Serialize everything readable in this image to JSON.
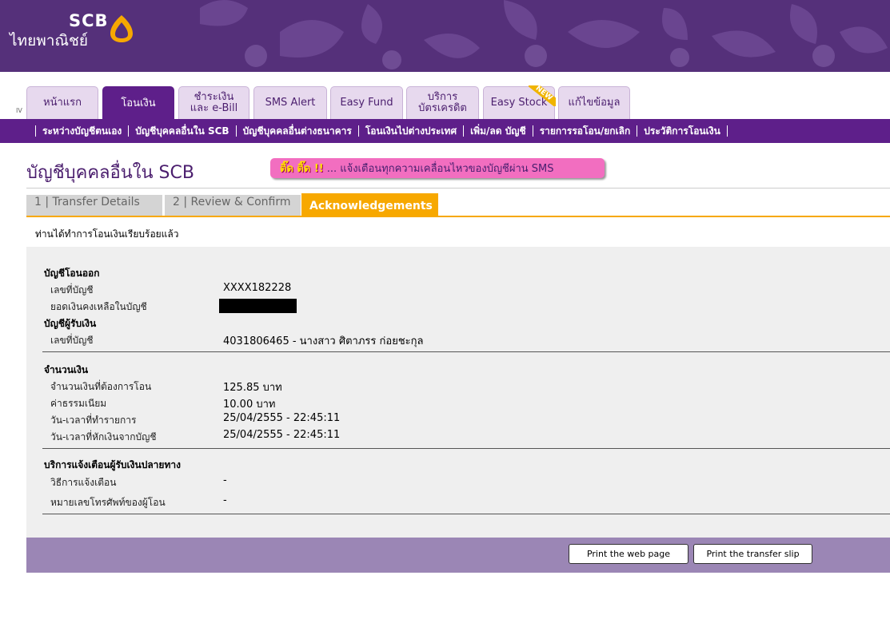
{
  "brand": {
    "name": "SCB",
    "thai_name": "ไทยพาณิชย์",
    "colors": {
      "primary": "#5e1f8a",
      "accent": "#f7a800",
      "banner": "#55307a"
    }
  },
  "side_mark": "IV",
  "tabs": [
    {
      "label": "หน้าแรก"
    },
    {
      "label": "โอนเงิน",
      "active": true
    },
    {
      "label": "ชำระเงิน และ e-Bill"
    },
    {
      "label": "SMS Alert"
    },
    {
      "label": "Easy Fund"
    },
    {
      "label": "บริการ บัตรเครดิต"
    },
    {
      "label": "Easy Stock",
      "badge": "NEW"
    },
    {
      "label": "แก้ไขข้อมูล"
    }
  ],
  "subnav": [
    "ระหว่างบัญชีตนเอง",
    "บัญชีบุคคลอื่นใน SCB",
    "บัญชีบุคคลอื่นต่างธนาคาร",
    "โอนเงินไปต่างประเทศ",
    "เพิ่ม/ลด บัญชี",
    "รายการรอโอน/ยกเลิก",
    "ประวัติการโอนเงิน"
  ],
  "page": {
    "title": "บัญชีบุคคลอื่นใน SCB",
    "sms_highlight": "ติ๊ด ติ๊ด !!",
    "sms_text": "... แจ้งเตือนทุกความเคลื่อนไหวของบัญชีผ่าน SMS"
  },
  "steps": [
    {
      "label": "1 | Transfer Details"
    },
    {
      "label": "2 | Review & Confirm"
    },
    {
      "label": "Acknowledgements",
      "active": true
    }
  ],
  "done_message": "ท่านได้ทำการโอนเงินเรียบร้อยแล้ว",
  "from_account": {
    "heading": "บัญชีโอนออก",
    "account_label": "เลขที่บัญชี",
    "account_value": "XXXX182228",
    "balance_label": "ยอดเงินคงเหลือในบัญชี"
  },
  "to_account": {
    "heading": "บัญชีผู้รับเงิน",
    "account_label": "เลขที่บัญชี",
    "account_value": "4031806465 - นางสาว ศิตาภรร ก่อยชะกุล"
  },
  "amount": {
    "heading": "จำนวนเงิน",
    "rows": [
      {
        "label": "จำนวนเงินที่ต้องการโอน",
        "value": "125.85 บาท"
      },
      {
        "label": "ค่าธรรมเนียม",
        "value": "10.00 บาท"
      },
      {
        "label": "วัน-เวลาที่ทำรายการ",
        "value": "25/04/2555 - 22:45:11"
      },
      {
        "label": "วัน-เวลาที่หักเงินจากบัญชี",
        "value": "25/04/2555 - 22:45:11"
      }
    ]
  },
  "notify": {
    "heading": "บริการแจ้งเตือนผู้รับเงินปลายทาง",
    "rows": [
      {
        "label": "วิธีการแจ้งเตือน",
        "value": "-"
      },
      {
        "label": "หมายเลขโทรศัพท์ของผู้โอน",
        "value": "-"
      }
    ]
  },
  "buttons": {
    "print_page": "Print the web page",
    "print_slip": "Print the transfer slip"
  }
}
